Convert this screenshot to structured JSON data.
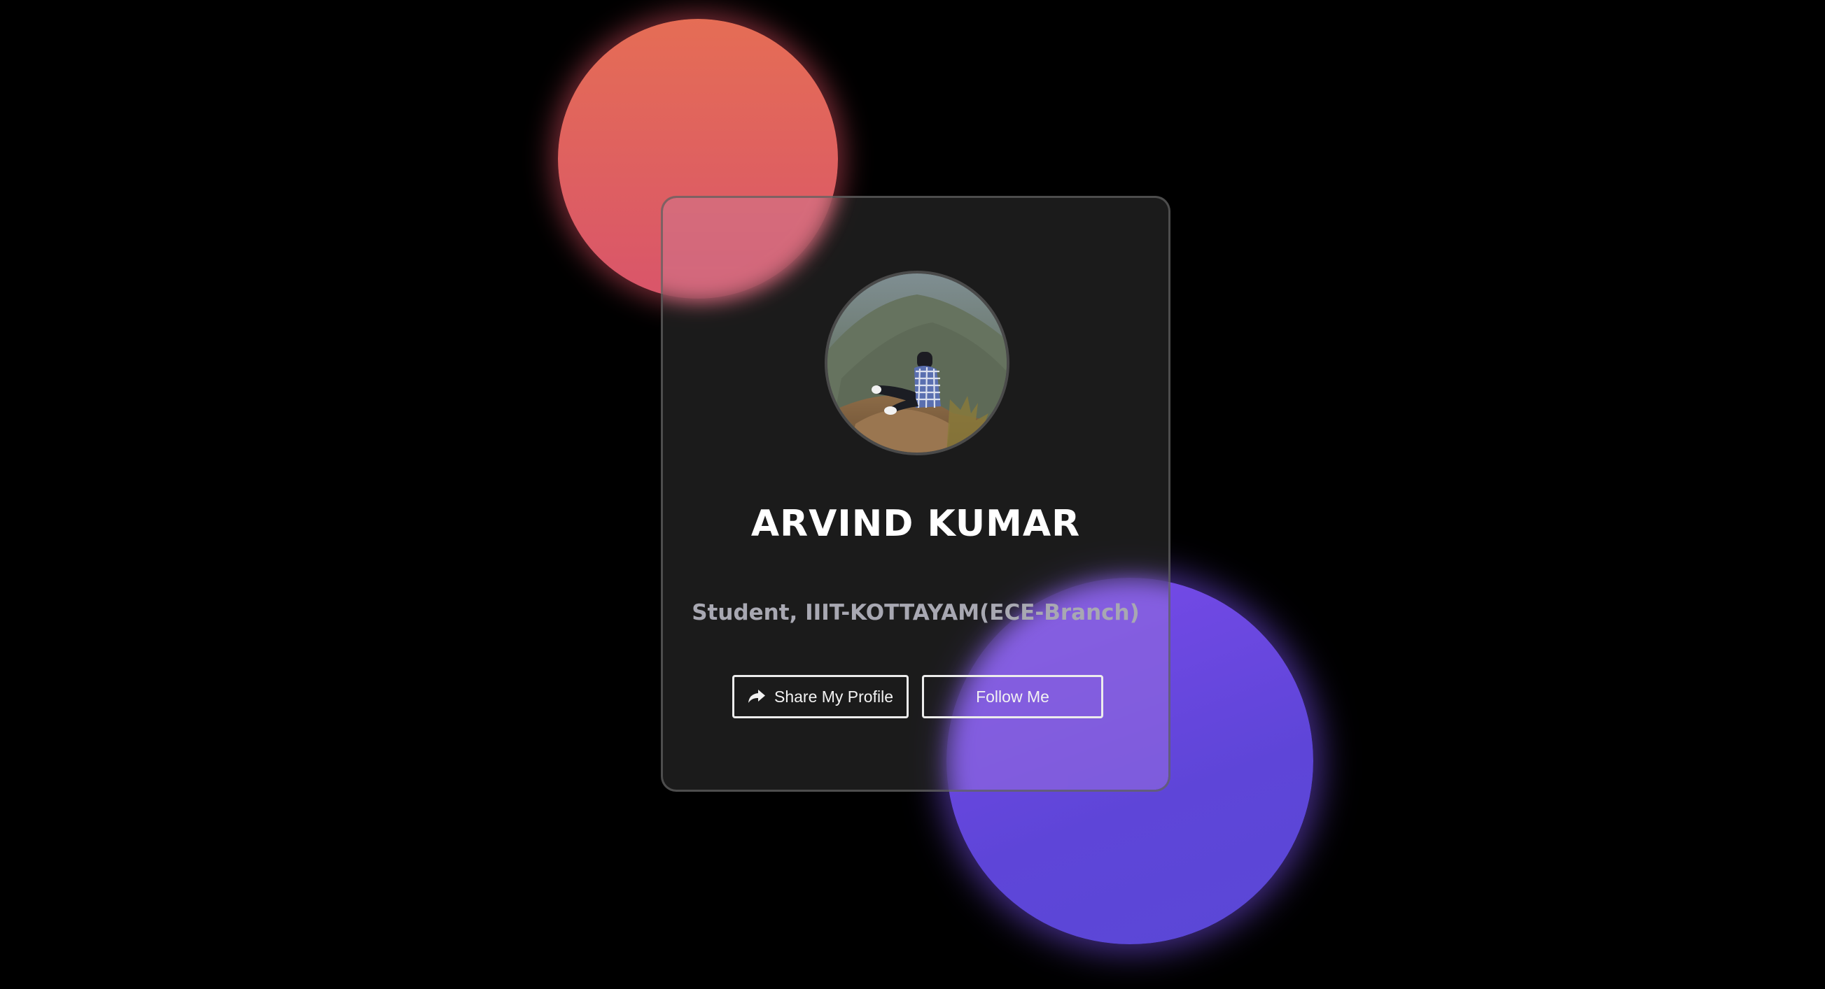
{
  "profile": {
    "name": "ARVIND KUMAR",
    "subtitle": "Student, IIIT-KOTTAYAM(ECE-Branch)",
    "avatar_alt": "profile-photo"
  },
  "actions": {
    "share_label": "Share My Profile",
    "share_icon": "share-arrow-icon",
    "follow_label": "Follow Me"
  },
  "colors": {
    "background": "#000000",
    "orange_blob": "#e56d55",
    "purple_blob": "#6a4ae0",
    "card": "#262626",
    "button_border": "#ececec"
  }
}
